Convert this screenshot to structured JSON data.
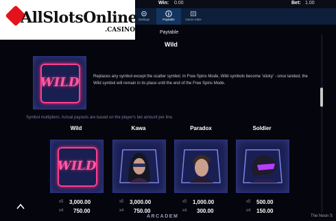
{
  "topbar": {
    "win_label": "Win:",
    "win_value": "0.00",
    "bet_label": "Bet:",
    "bet_value": "1.00"
  },
  "tabs": [
    {
      "label": "Settings",
      "icon": "gear-icon"
    },
    {
      "label": "Paytable",
      "icon": "info-icon"
    },
    {
      "label": "Game rules",
      "icon": "rules-icon"
    }
  ],
  "logo": {
    "text": "AllSlotsOnline",
    "sub": ".CASINO"
  },
  "paytable": {
    "title": "Paytable",
    "wild_heading": "Wild",
    "wild_symbol_text": "WILD",
    "wild_description": "Replaces any symbol except the scatter symbol. In Free Spins Mode, Wild symbols become 'sticky' - once landed, the Wild symbol will remain in its place until the end of the Free Spins Mode.",
    "multipliers_note": "Symbol multipliers. Actual payouts are based on the player's bet amount per line.",
    "symbols": [
      {
        "name": "Wild",
        "pays": [
          {
            "x": "x5",
            "value": "3,000.00"
          },
          {
            "x": "x4",
            "value": "750.00"
          }
        ]
      },
      {
        "name": "Kawa",
        "pays": [
          {
            "x": "x5",
            "value": "3,000.00"
          },
          {
            "x": "x4",
            "value": "750.00"
          }
        ]
      },
      {
        "name": "Paradox",
        "pays": [
          {
            "x": "x5",
            "value": "1,000.00"
          },
          {
            "x": "x4",
            "value": "300.00"
          }
        ]
      },
      {
        "name": "Soldier",
        "pays": [
          {
            "x": "x5",
            "value": "500.00"
          },
          {
            "x": "x4",
            "value": "150.00"
          }
        ]
      }
    ]
  },
  "footer": {
    "brand": "ARCADEM",
    "game": "The Neon S"
  },
  "colors": {
    "background": "#05060d",
    "tabbar": "#0d1f3a",
    "wild_pink": "#ff3f8f",
    "card": "#1a1f52"
  }
}
